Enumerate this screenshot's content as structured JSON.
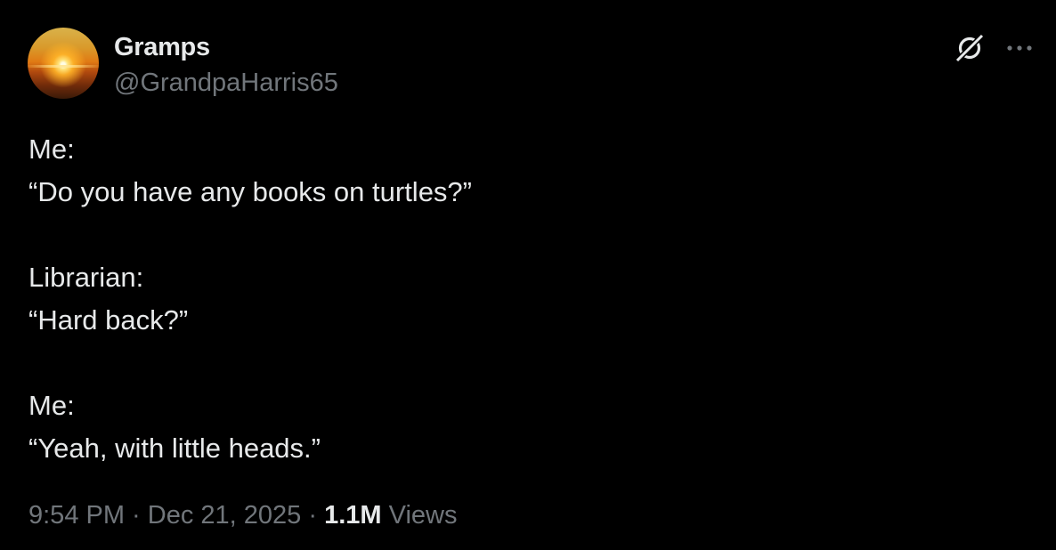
{
  "author": {
    "display_name": "Gramps",
    "handle": "@GrandpaHarris65",
    "avatar": "sunset-avatar"
  },
  "actions": {
    "grok_icon": "grok-icon",
    "more_icon": "more-dots-icon"
  },
  "post": {
    "lines": [
      "Me:",
      "“Do you have any books on turtles?”",
      "",
      "Librarian:",
      "“Hard back?”",
      "",
      "Me:",
      "“Yeah, with little heads.”"
    ]
  },
  "meta": {
    "time": "9:54 PM",
    "sep1": " · ",
    "date": "Dec 21, 2025",
    "sep2": " · ",
    "views_count": "1.1M",
    "views_label": " Views"
  },
  "colors": {
    "background": "#000000",
    "primary_text": "#e7e9ea",
    "secondary_text": "#71767b"
  }
}
